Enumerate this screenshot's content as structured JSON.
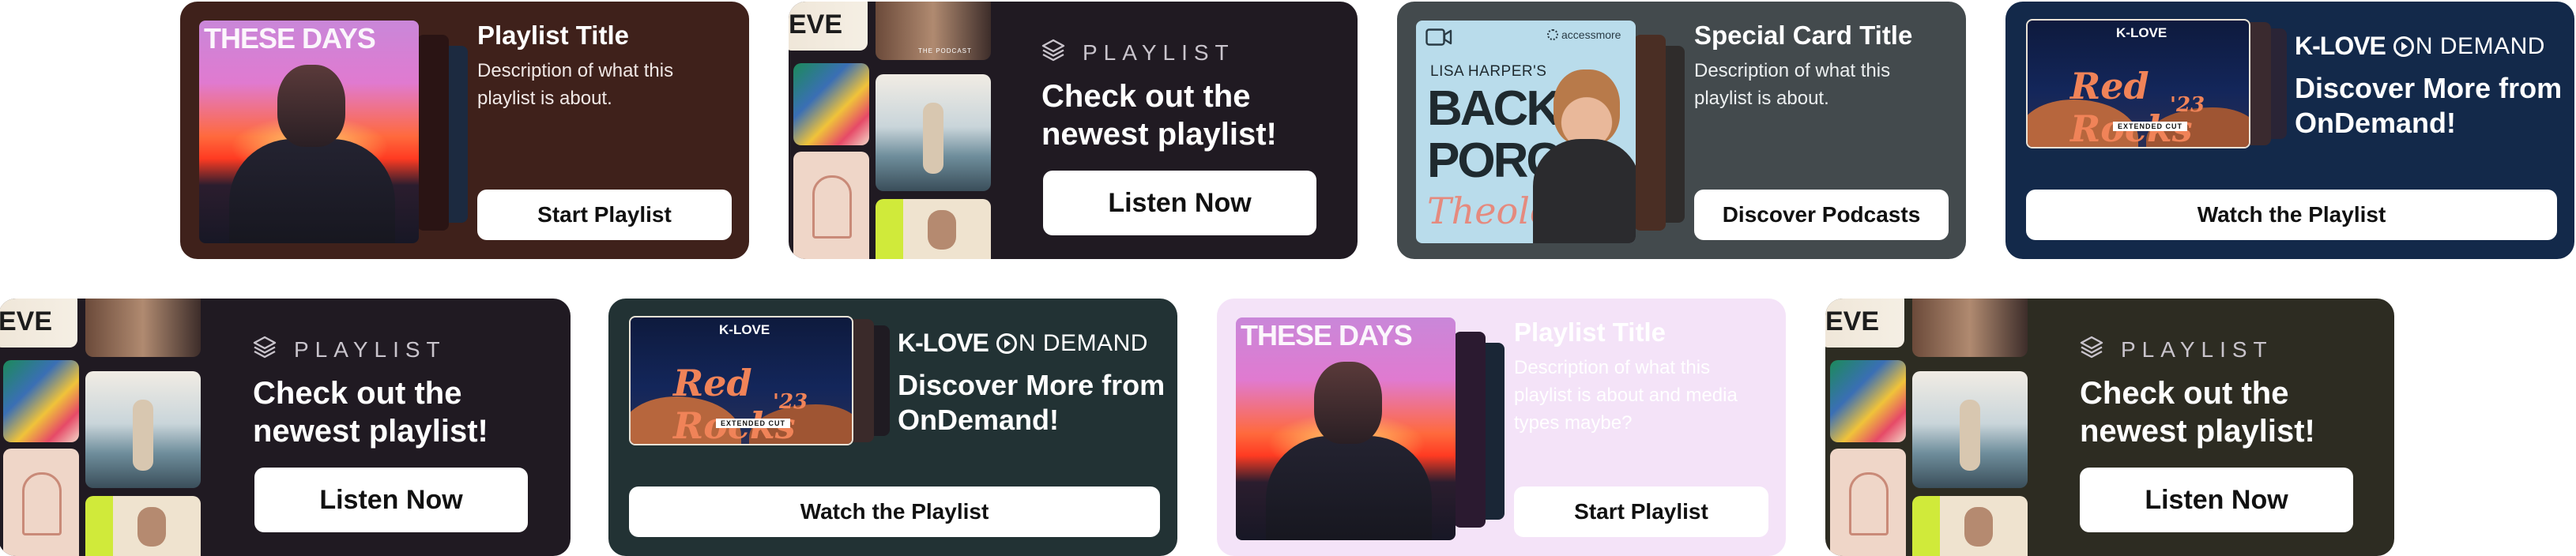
{
  "cards": {
    "c1": {
      "art_text": "THESE DAYS",
      "title": "Playlist Title",
      "desc_l1": "Description of what this",
      "desc_l2": "playlist is about.",
      "button": "Start Playlist"
    },
    "c2": {
      "eyebrow": "PLAYLIST",
      "title_l1": "Check out the",
      "title_l2": "newest playlist!",
      "button": "Listen Now",
      "tile_labels": [
        "EVE",
        "THE PODCAST"
      ]
    },
    "c3": {
      "art_brand": "accessmore",
      "art_host": "LISA HARPER'S",
      "art_t1": "BACK",
      "art_t2": "PORCH",
      "art_t3": "Theology",
      "title": "Special Card Title",
      "desc_l1": "Description of what this",
      "desc_l2": "playlist is about.",
      "button": "Discover Podcasts"
    },
    "c4": {
      "art_logo": "K-LOVE",
      "art_t1": "Red Rocks",
      "art_t2": "'23",
      "art_tag": "EXTENDED CUT",
      "brand_k": "K-LOVE",
      "brand_rest": "N DEMAND",
      "title_l1": "Discover More from",
      "title_l2": "OnDemand!",
      "button": "Watch the Playlist"
    },
    "c5": {
      "eyebrow": "PLAYLIST",
      "title_l1": "Check out the",
      "title_l2": "newest playlist!",
      "button": "Listen Now"
    },
    "c6": {
      "art_logo": "K-LOVE",
      "art_t1": "Red Rocks",
      "art_t2": "'23",
      "art_tag": "EXTENDED CUT",
      "brand_k": "K-LOVE",
      "brand_rest": "N DEMAND",
      "title_l1": "Discover More from",
      "title_l2": "OnDemand!",
      "button": "Watch the Playlist"
    },
    "c7": {
      "art_text": "THESE DAYS",
      "title": "Playlist Title",
      "desc_l1": "Description of what this",
      "desc_l2": "playlist is about and media",
      "desc_l3": "types maybe?",
      "button": "Start Playlist"
    },
    "c8": {
      "eyebrow": "PLAYLIST",
      "title_l1": "Check out the",
      "title_l2": "newest playlist!",
      "button": "Listen Now"
    }
  },
  "colors": {
    "c1_bg": "#3f211b",
    "c2_bg": "#201a22",
    "c3_bg": "#434a4d",
    "c4_bg": "#13294a",
    "c5_bg": "#201a22",
    "c6_bg": "#223234",
    "c7_bg": "#f4e3f8",
    "c8_bg": "#2d2c22"
  }
}
